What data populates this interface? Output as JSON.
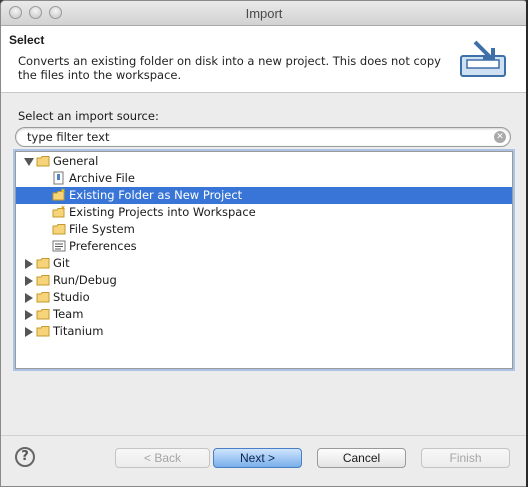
{
  "window": {
    "title": "Import"
  },
  "header": {
    "title": "Select",
    "description": "Converts an existing folder on disk into a new project. This does not copy the files into the workspace.",
    "icon": "import-wizard-icon"
  },
  "source": {
    "label": "Select an import source:",
    "filter_value": "type filter text"
  },
  "tree": [
    {
      "label": "General",
      "expanded": true,
      "icon": "folder-icon"
    },
    {
      "label": "Archive File",
      "icon": "archive-file-icon"
    },
    {
      "label": "Existing Folder as New Project",
      "icon": "new-project-icon",
      "selected": true
    },
    {
      "label": "Existing Projects into Workspace",
      "icon": "projects-icon"
    },
    {
      "label": "File System",
      "icon": "folder-icon"
    },
    {
      "label": "Preferences",
      "icon": "preferences-icon"
    },
    {
      "label": "Git",
      "expanded": false,
      "icon": "folder-icon"
    },
    {
      "label": "Run/Debug",
      "expanded": false,
      "icon": "folder-icon"
    },
    {
      "label": "Studio",
      "expanded": false,
      "icon": "folder-icon"
    },
    {
      "label": "Team",
      "expanded": false,
      "icon": "folder-icon"
    },
    {
      "label": "Titanium",
      "expanded": false,
      "icon": "folder-icon"
    }
  ],
  "buttons": {
    "help": "?",
    "back": "< Back",
    "next": "Next >",
    "cancel": "Cancel",
    "finish": "Finish"
  },
  "colors": {
    "selection": "#3875d7",
    "accent": "#79aeea"
  }
}
